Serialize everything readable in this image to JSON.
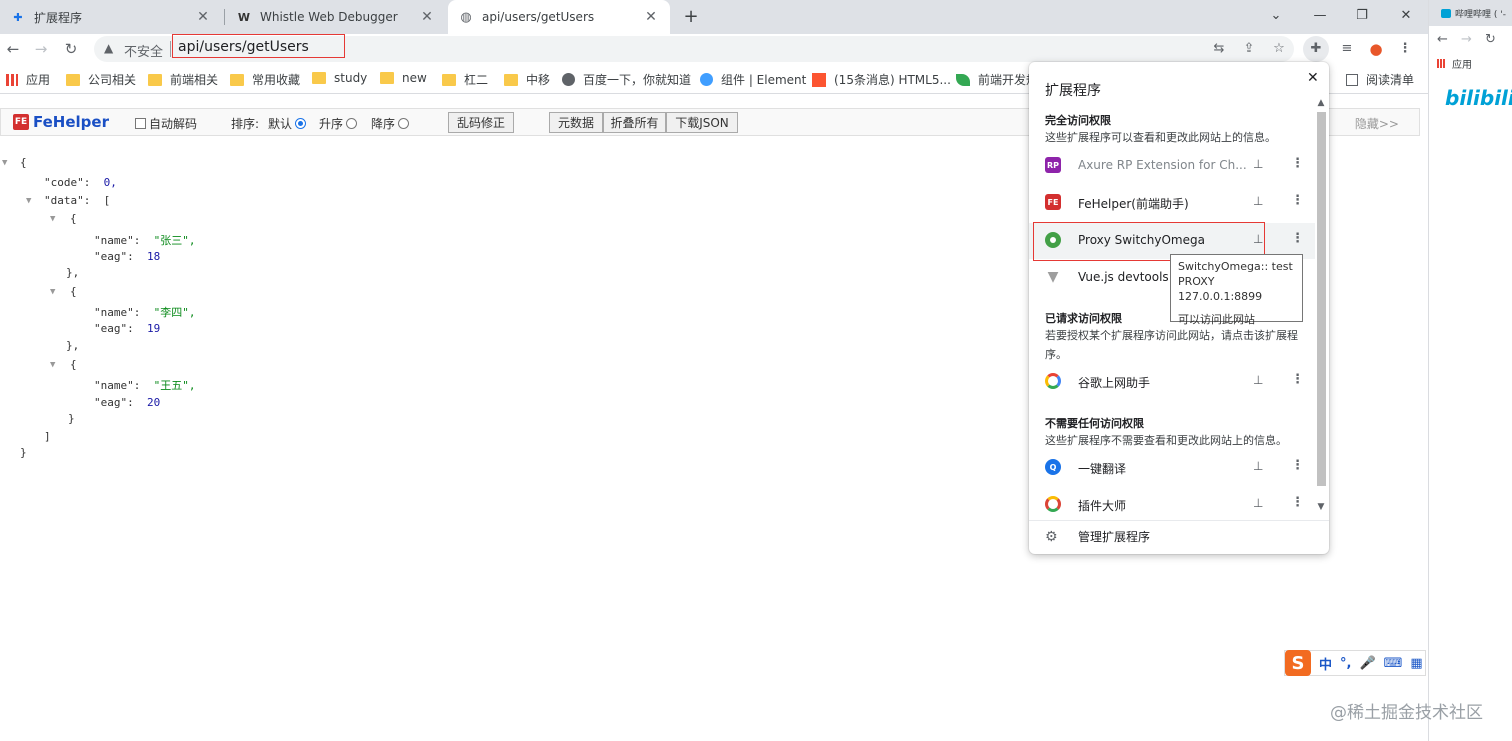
{
  "tabs": [
    {
      "title": "扩展程序",
      "icon": "puzzle-icon"
    },
    {
      "title": "Whistle Web Debugger",
      "icon": "whistle-icon"
    },
    {
      "title": "api/users/getUsers",
      "icon": "globe-icon"
    }
  ],
  "toolbar": {
    "security_label": "不安全",
    "url": "api/users/getUsers"
  },
  "bookmarks": [
    {
      "label": "应用"
    },
    {
      "label": "公司相关"
    },
    {
      "label": "前端相关"
    },
    {
      "label": "常用收藏"
    },
    {
      "label": "study"
    },
    {
      "label": "new"
    },
    {
      "label": "杠二"
    },
    {
      "label": "中移"
    },
    {
      "label": "百度一下，你就知道"
    },
    {
      "label": "组件 | Element"
    },
    {
      "label": "(15条消息) HTML5..."
    },
    {
      "label": "前端开发规"
    },
    {
      "label": "阅读清单"
    }
  ],
  "fehelper": {
    "logo": "FeHelper",
    "logo_badge": "FE",
    "auto_decode": "自动解码",
    "sort_label": "排序:",
    "sort_default": "默认",
    "sort_asc": "升序",
    "sort_desc": "降序",
    "fix_garbled": "乱码修正",
    "raw_data": "元数据",
    "fold_all": "折叠所有",
    "download_json": "下载JSON",
    "hide": "隐藏>>"
  },
  "json": {
    "code_key": "\"code\"",
    "code_val": "0,",
    "data_key": "\"data\"",
    "items": [
      {
        "name_key": "\"name\"",
        "name_val": "\"张三\",",
        "eag_key": "\"eag\"",
        "eag_val": "18"
      },
      {
        "name_key": "\"name\"",
        "name_val": "\"李四\",",
        "eag_key": "\"eag\"",
        "eag_val": "19"
      },
      {
        "name_key": "\"name\"",
        "name_val": "\"王五\",",
        "eag_key": "\"eag\"",
        "eag_val": "20"
      }
    ]
  },
  "extensions_popup": {
    "title": "扩展程序",
    "full_access_head": "完全访问权限",
    "full_access_desc": "这些扩展程序可以查看和更改此网站上的信息。",
    "full_access_items": [
      {
        "name": "Axure RP Extension for Ch...",
        "icon": "axure-icon",
        "color": "#8e24aa"
      },
      {
        "name": "FeHelper(前端助手)",
        "icon": "fehelper-icon",
        "color": "#d32f2f"
      },
      {
        "name": "Proxy SwitchyOmega",
        "icon": "switchyomega-icon",
        "color": "#43a047"
      },
      {
        "name": "Vue.js devtools",
        "icon": "vue-icon",
        "color": "#9e9e9e"
      }
    ],
    "requested_head": "已请求访问权限",
    "requested_desc": "若要授权某个扩展程序访问此网站，请点击该扩展程序。",
    "requested_items": [
      {
        "name": "谷歌上网助手",
        "icon": "google-helper-icon",
        "color": "#4285f4"
      }
    ],
    "no_access_head": "不需要任何访问权限",
    "no_access_desc": "这些扩展程序不需要查看和更改此网站上的信息。",
    "no_access_items": [
      {
        "name": "一键翻译",
        "icon": "translate-icon",
        "color": "#1a73e8"
      },
      {
        "name": "插件大师",
        "icon": "chrome-master-icon",
        "color": "#db4437"
      }
    ],
    "manage": "管理扩展程序"
  },
  "tooltip": {
    "line1": "SwitchyOmega:: test",
    "line2": "PROXY 127.0.0.1:8899",
    "line3": "可以访问此网站"
  },
  "side_window": {
    "tab_title": "哔哩哔哩 ( '-",
    "app": "应用",
    "logo": "bilibili"
  },
  "ime": {
    "logo": "S",
    "mode": "中"
  },
  "watermark": "@稀土掘金技术社区"
}
